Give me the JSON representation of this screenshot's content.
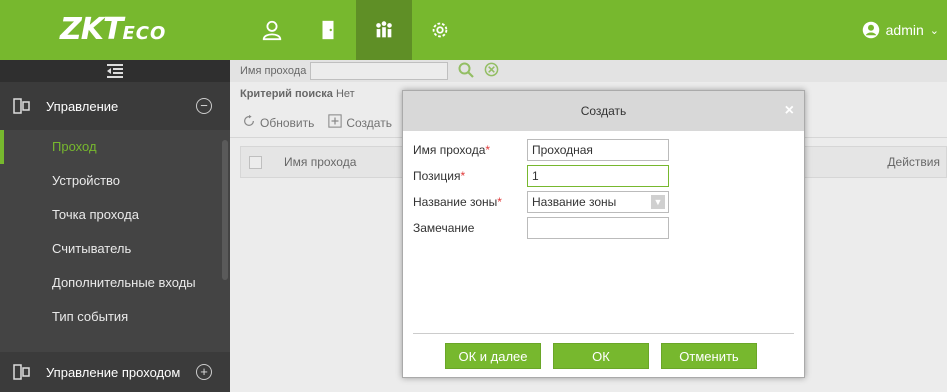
{
  "header": {
    "logo_main": "ZKT",
    "logo_sub": "ECO",
    "user_name": "admin",
    "accent_color": "#77b82e"
  },
  "sidebar": {
    "sections": [
      {
        "label": "Управление",
        "toggle": "−",
        "icon": "door-device-icon"
      },
      {
        "label": "Управление проходом",
        "toggle": "+",
        "icon": "door-device-icon"
      }
    ],
    "items": [
      {
        "label": "Проход",
        "active": true
      },
      {
        "label": "Устройство"
      },
      {
        "label": "Точка прохода"
      },
      {
        "label": "Считыватель"
      },
      {
        "label": "Дополнительные входы"
      },
      {
        "label": "Тип события"
      }
    ]
  },
  "search": {
    "label": "Имя прохода",
    "value": ""
  },
  "criteria": {
    "label": "Критерий поиска",
    "value": "Нет"
  },
  "toolbar": {
    "refresh_label": "Обновить",
    "create_label": "Создать"
  },
  "table": {
    "columns": [
      "Имя прохода",
      "Действия"
    ]
  },
  "dialog": {
    "title": "Создать",
    "fields": [
      {
        "label": "Имя прохода",
        "required": "*",
        "value": "Проходная"
      },
      {
        "label": "Позиция",
        "required": "*",
        "value": "1"
      },
      {
        "label": "Название зоны",
        "required": "*",
        "value": "Название зоны"
      },
      {
        "label": "Замечание",
        "required": "",
        "value": ""
      }
    ],
    "buttons": {
      "ok_next": "ОК и далее",
      "ok": "ОК",
      "cancel": "Отменить"
    }
  }
}
